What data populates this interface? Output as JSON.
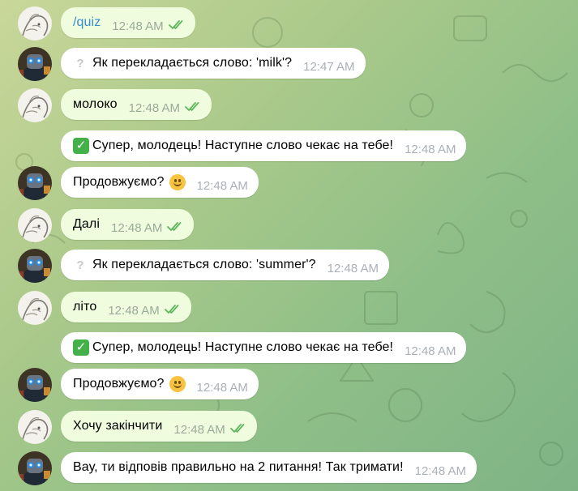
{
  "colors": {
    "outgoing_bubble": "#effdde",
    "incoming_bubble": "#ffffff",
    "command_link": "#3a8bd0",
    "read_ticks": "#5fb55e",
    "background_start": "#c9d79a",
    "background_end": "#7fb386"
  },
  "messages": [
    {
      "sender": "user",
      "text": "/quiz",
      "time": "12:48 AM",
      "status": "read",
      "command": true
    },
    {
      "sender": "bot",
      "prefix_icon": "question-mark-icon",
      "text": "Як перекладається слово: 'milk'?",
      "time": "12:47 AM"
    },
    {
      "sender": "user",
      "text": "молоко",
      "time": "12:48 AM",
      "status": "read"
    },
    {
      "sender": "bot",
      "prefix_icon": "check-mark-icon",
      "text": "Супер, молодець! Наступне слово чекає на тебе!",
      "time": "12:48 AM",
      "continuation": true
    },
    {
      "sender": "bot",
      "text": "Продовжуємо?",
      "suffix_icon": "smile-emoji-icon",
      "time": "12:48 AM"
    },
    {
      "sender": "user",
      "text": "Далі",
      "time": "12:48 AM",
      "status": "read"
    },
    {
      "sender": "bot",
      "prefix_icon": "question-mark-icon",
      "text": "Як перекладається слово: 'summer'?",
      "time": "12:48 AM"
    },
    {
      "sender": "user",
      "text": "літо",
      "time": "12:48 AM",
      "status": "read"
    },
    {
      "sender": "bot",
      "prefix_icon": "check-mark-icon",
      "text": "Супер, молодець! Наступне слово чекає на тебе!",
      "time": "12:48 AM",
      "continuation": true
    },
    {
      "sender": "bot",
      "text": "Продовжуємо?",
      "suffix_icon": "smile-emoji-icon",
      "time": "12:48 AM"
    },
    {
      "sender": "user",
      "text": "Хочу закінчити",
      "time": "12:48 AM",
      "status": "read"
    },
    {
      "sender": "bot",
      "text": "Вау, ти відповів правильно на 2 питання! Так тримати!",
      "time": "12:48 AM"
    }
  ]
}
